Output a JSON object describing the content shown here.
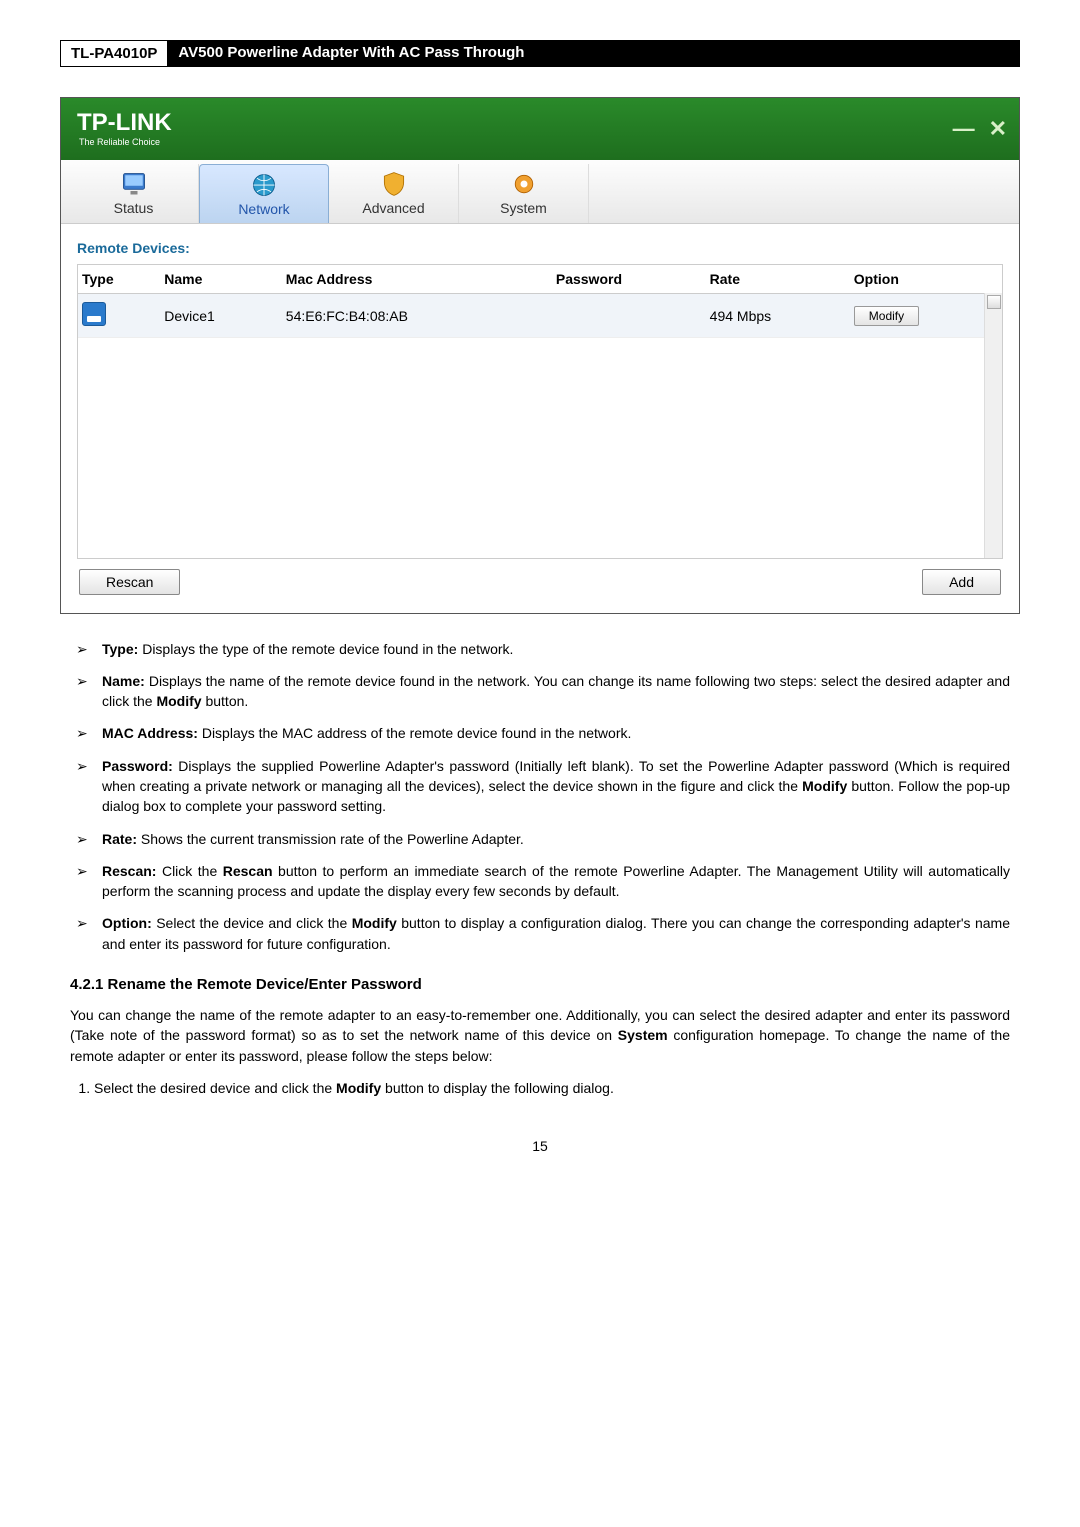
{
  "docHeader": {
    "model": "TL-PA4010P",
    "title": " AV500 Powerline Adapter With AC Pass Through"
  },
  "app": {
    "logo": "TP-LINK",
    "tagline": "The Reliable Choice",
    "tabs": {
      "status": "Status",
      "network": "Network",
      "advanced": "Advanced",
      "system": "System"
    },
    "sectionTitle": "Remote Devices:",
    "columns": {
      "type": "Type",
      "name": "Name",
      "mac": "Mac Address",
      "password": "Password",
      "rate": "Rate",
      "option": "Option"
    },
    "row": {
      "name": "Device1",
      "mac": "54:E6:FC:B4:08:AB",
      "password": "",
      "rate": "494 Mbps",
      "modify": "Modify"
    },
    "buttons": {
      "rescan": "Rescan",
      "add": "Add"
    }
  },
  "desc": {
    "type": {
      "label": "Type:",
      "text": " Displays the type of the remote device found in the network."
    },
    "name": {
      "label": "Name:",
      "text": " Displays the name of the remote device found in the network. You can change its name following two steps: select the desired adapter and click the ",
      "b1": "Modify",
      "t2": " button."
    },
    "mac": {
      "label": "MAC Address:",
      "text": " Displays the MAC address of the remote device found in the network."
    },
    "password": {
      "label": "Password:",
      "t1": " Displays the supplied Powerline Adapter's password (Initially left blank). To set the Powerline Adapter password (Which is required when creating a private network or managing all the devices), select the device shown in the figure and click the ",
      "b1": "Modify",
      "t2": " button. Follow the pop-up dialog box to complete your password setting."
    },
    "rate": {
      "label": "Rate:",
      "text": " Shows the current transmission rate of the Powerline Adapter."
    },
    "rescan": {
      "label": "Rescan:",
      "t1": " Click the ",
      "b1": "Rescan",
      "t2": " button to perform an immediate search of the remote Powerline Adapter. The Management Utility will automatically perform the scanning process and update the display every few seconds by default."
    },
    "option": {
      "label": "Option:",
      "t1": " Select the device and click the ",
      "b1": "Modify",
      "t2": " button to display a configuration dialog. There you can change the corresponding adapter's name and enter its password for future configuration."
    }
  },
  "section421": {
    "heading": "4.2.1 Rename the Remote Device/Enter Password",
    "p1a": "You can change the name of the remote adapter to an easy-to-remember one. Additionally, you can select the desired adapter and enter its password (Take note of the password format) so as to set the network name of this device on ",
    "p1b": "System",
    "p1c": " configuration homepage. To change the name of the remote adapter or enter its password, please follow the steps below:",
    "step1a": "Select the desired device and click the ",
    "step1b": "Modify",
    "step1c": " button to display the following dialog."
  },
  "pageNumber": "15"
}
